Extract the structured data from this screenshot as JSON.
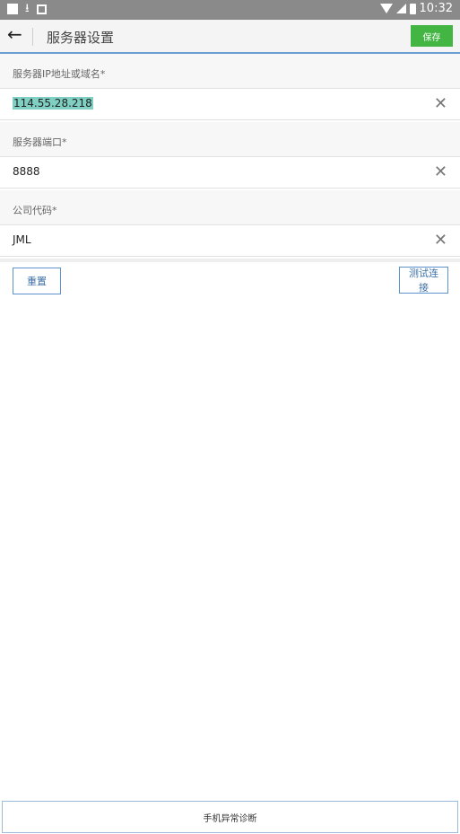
{
  "status_bar": {
    "time": "10:32"
  },
  "app_bar": {
    "title": "服务器设置",
    "save_label": "保存"
  },
  "fields": [
    {
      "label": "服务器IP地址或域名*",
      "value": "114.55.28.218"
    },
    {
      "label": "服务器端口*",
      "value": "8888"
    },
    {
      "label": "公司代码*",
      "value": "JML"
    }
  ],
  "actions": {
    "reset_label": "重置",
    "test_label": "测试连接"
  },
  "footer": {
    "diagnose_label": "手机异常诊断"
  },
  "colors": {
    "accent": "#43b543",
    "link": "#5c93cc",
    "selection": "#7fd0c2"
  },
  "icons": {
    "back": "back-arrow-icon",
    "clear": "close-icon",
    "status": [
      "notification-icon",
      "download-icon",
      "image-icon",
      "wifi-icon",
      "signal-icon",
      "battery-icon"
    ]
  }
}
